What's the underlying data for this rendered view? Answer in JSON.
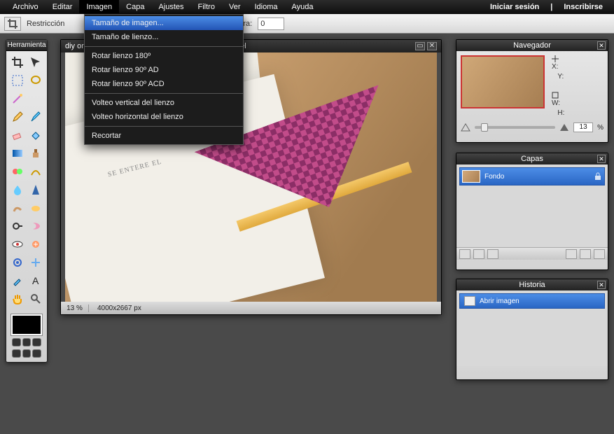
{
  "menubar": {
    "items": [
      "Archivo",
      "Editar",
      "Imagen",
      "Capa",
      "Ajustes",
      "Filtro",
      "Ver",
      "Idioma",
      "Ayuda"
    ],
    "active_index": 2,
    "right": {
      "login": "Iniciar sesión",
      "sep": "|",
      "signup": "Inscribirse"
    }
  },
  "dropdown": {
    "items": [
      {
        "label": "Tamaño de imagen...",
        "selected": true
      },
      {
        "label": "Tamaño de lienzo..."
      },
      {
        "sep": true
      },
      {
        "label": "Rotar lienzo 180º"
      },
      {
        "label": "Rotar lienzo 90º AD"
      },
      {
        "label": "Rotar lienzo 90º ACD"
      },
      {
        "sep": true
      },
      {
        "label": "Volteo vertical del lienzo"
      },
      {
        "label": "Volteo horizontal del lienzo"
      },
      {
        "sep": true
      },
      {
        "label": "Recortar"
      }
    ]
  },
  "optionsbar": {
    "restriccion_label": "Restricción",
    "altura_label": "Altura:",
    "altura_value": "0"
  },
  "tools_panel": {
    "title": "Herramienta"
  },
  "document": {
    "title": "diy origami - como hacer un marcapáginas con papel",
    "zoom": "13",
    "zoom_unit": "%",
    "dimensions": "4000x2667 px",
    "book_heading": "SE ENTERE EL"
  },
  "navigator": {
    "title": "Navegador",
    "x_label": "X:",
    "y_label": "Y:",
    "w_label": "W:",
    "h_label": "H:",
    "zoom": "13",
    "zoom_unit": "%"
  },
  "layers": {
    "title": "Capas",
    "items": [
      {
        "name": "Fondo",
        "locked": true
      }
    ]
  },
  "history": {
    "title": "Historia",
    "items": [
      {
        "label": "Abrir imagen"
      }
    ]
  }
}
